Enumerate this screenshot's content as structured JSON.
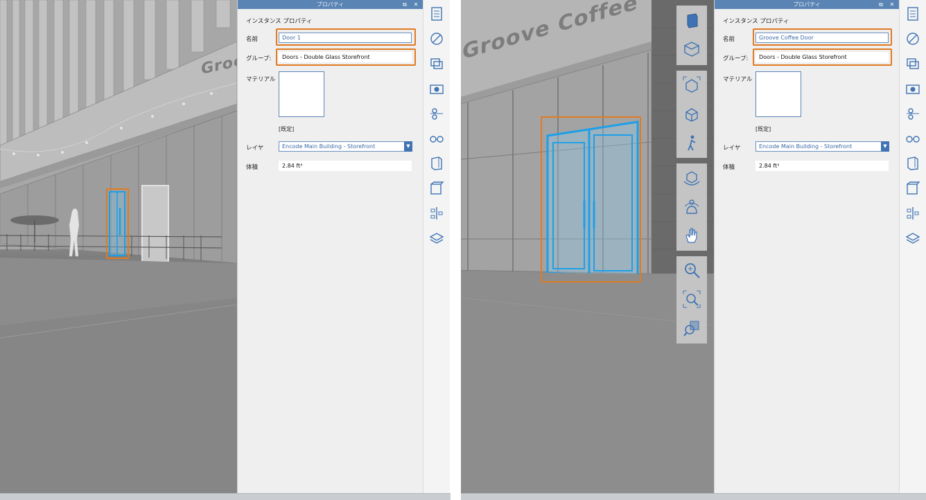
{
  "panel": {
    "title": "プロパティ",
    "heading": "インスタンス プロパティ",
    "labels": {
      "name": "名前",
      "group": "グループ:",
      "material": "マテリアル",
      "layer": "レイヤ",
      "volume": "体積"
    },
    "material_default": "[既定]",
    "volume_value": "2.84 ft³",
    "group_value": "Doors - Double Glass Storefront",
    "layer_value": "Encode Main Building - Storefront"
  },
  "left": {
    "name_value": "Door 1",
    "storefront_sign": "Groove"
  },
  "right": {
    "name_value": "Groove Coffee Door",
    "storefront_sign": "Groove Coffee"
  },
  "icons": {
    "right_iconbar": [
      "properties-icon",
      "materials-icon",
      "layers-icon",
      "camera-icon",
      "sun-position-icon",
      "view-settings-icon",
      "section-box-icon",
      "sketch-icon",
      "model-tree-icon",
      "stack-icon"
    ],
    "nav_toolbar": [
      "view-cube-front-icon",
      "view-cube-top-icon",
      "orbit-icon",
      "perspective-icon",
      "walk-icon",
      "rotate-icon",
      "look-icon",
      "pan-icon",
      "zoom-icon",
      "zoom-window-icon",
      "zoom-fit-icon"
    ]
  },
  "colors": {
    "highlight": "#e07b22",
    "selection": "#22a8f0",
    "title_bar": "#5a84b4"
  }
}
